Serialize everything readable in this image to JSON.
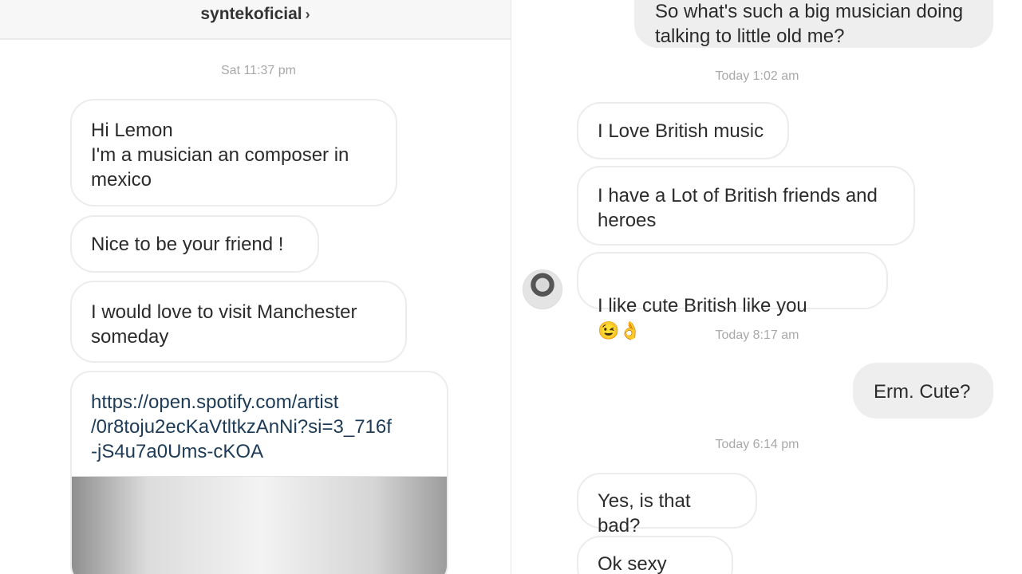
{
  "left": {
    "header": {
      "title": "syntekoficial",
      "chevron": "›"
    },
    "timestamp": "Sat 11:37 pm",
    "messages": [
      "Hi Lemon\nI'm a musician an composer in\nmexico",
      "Nice to be your friend !",
      "I would love to visit Manchester\nsomeday"
    ],
    "link": "https://open.spotify.com/artist\n/0r8toju2ecKaVtltkzAnNi?si=3_716f\n-jS4u7a0Ums-cKOA"
  },
  "right": {
    "top_sent": "So what's such a big musician doing\ntalking to little old me?",
    "ts1": "Today 1:02 am",
    "recv1": [
      "I Love British music",
      "I have  a Lot of British friends and\nheroes",
      "I like cute British like you"
    ],
    "emoji1": "😉👌",
    "ts2": "Today 8:17 am",
    "sent2": "Erm.  Cute?",
    "ts3": "Today 6:14 pm",
    "recv3": [
      "Yes, is that bad?",
      "Ok sexy haha"
    ]
  }
}
